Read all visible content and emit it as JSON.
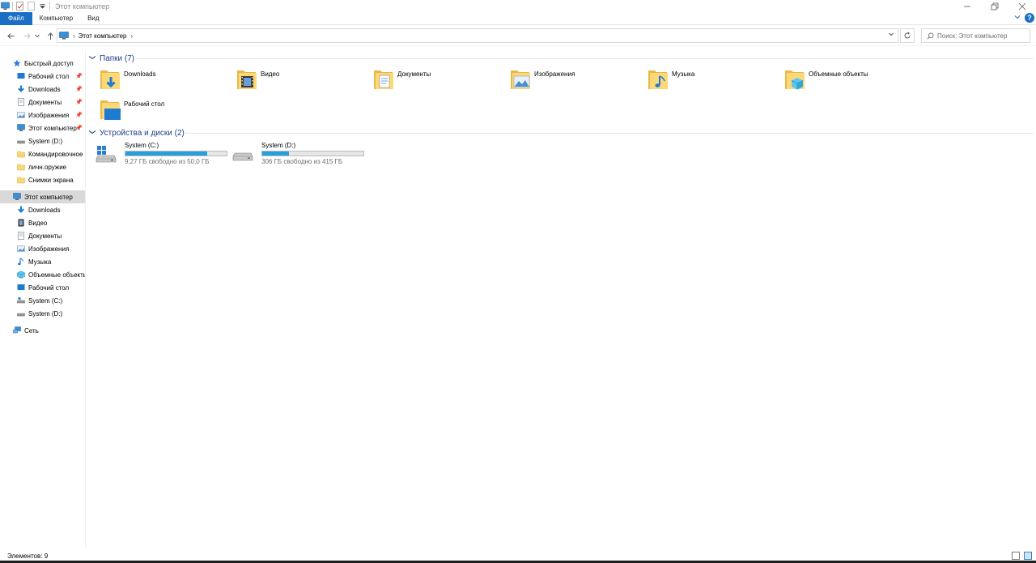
{
  "window": {
    "title": "Этот компьютер"
  },
  "ribbon": {
    "tabs": [
      "Файл",
      "Компьютер",
      "Вид"
    ]
  },
  "address": {
    "crumb": "Этот компьютер"
  },
  "search": {
    "placeholder": "Поиск: Этот компьютер"
  },
  "sidebar": {
    "quick_access": "Быстрый доступ",
    "quick_items": [
      {
        "label": "Рабочий стол",
        "icon": "desktop-icon",
        "pinned": true
      },
      {
        "label": "Downloads",
        "icon": "download-arrow-icon",
        "pinned": true
      },
      {
        "label": "Документы",
        "icon": "documents-icon",
        "pinned": true
      },
      {
        "label": "Изображения",
        "icon": "pictures-icon",
        "pinned": true
      },
      {
        "label": "Этот компьютер",
        "icon": "computer-icon",
        "pinned": true
      },
      {
        "label": "System (D:)",
        "icon": "drive-icon",
        "pinned": false
      },
      {
        "label": "Командировочное",
        "icon": "folder-icon",
        "pinned": false
      },
      {
        "label": "личн.оружие",
        "icon": "folder-icon",
        "pinned": false
      },
      {
        "label": "Снимки экрана",
        "icon": "folder-icon",
        "pinned": false
      }
    ],
    "this_pc": "Этот компьютер",
    "pc_items": [
      {
        "label": "Downloads",
        "icon": "download-arrow-icon"
      },
      {
        "label": "Видео",
        "icon": "video-icon"
      },
      {
        "label": "Документы",
        "icon": "documents-icon"
      },
      {
        "label": "Изображения",
        "icon": "pictures-icon"
      },
      {
        "label": "Музыка",
        "icon": "music-icon"
      },
      {
        "label": "Объемные объекты",
        "icon": "3d-objects-icon"
      },
      {
        "label": "Рабочий стол",
        "icon": "desktop-icon"
      },
      {
        "label": "System (C:)",
        "icon": "drive-icon"
      },
      {
        "label": "System (D:)",
        "icon": "drive-icon"
      }
    ],
    "network": "Сеть"
  },
  "content": {
    "folders_header": "Папки (7)",
    "folders": [
      {
        "label": "Downloads",
        "icon": "downloads-folder-icon"
      },
      {
        "label": "Видео",
        "icon": "video-folder-icon"
      },
      {
        "label": "Документы",
        "icon": "documents-folder-icon"
      },
      {
        "label": "Изображения",
        "icon": "pictures-folder-icon"
      },
      {
        "label": "Музыка",
        "icon": "music-folder-icon"
      },
      {
        "label": "Объемные объекты",
        "icon": "3d-objects-folder-icon"
      },
      {
        "label": "Рабочий стол",
        "icon": "desktop-folder-icon"
      }
    ],
    "drives_header": "Устройства и диски (2)",
    "drives": [
      {
        "name": "System (C:)",
        "free_text": "9,27 ГБ свободно из 50,0 ГБ",
        "used_fraction": 0.81,
        "icon": "windows-drive-icon"
      },
      {
        "name": "System (D:)",
        "free_text": "306 ГБ свободно из 415 ГБ",
        "used_fraction": 0.26,
        "icon": "drive-icon"
      }
    ]
  },
  "status": {
    "items_count": "Элементов: 9"
  },
  "colors": {
    "accent": "#1a6fc4",
    "group_header": "#1e3f8a",
    "drive_fill": "#26a0da",
    "selection": "#d9d9d9"
  }
}
